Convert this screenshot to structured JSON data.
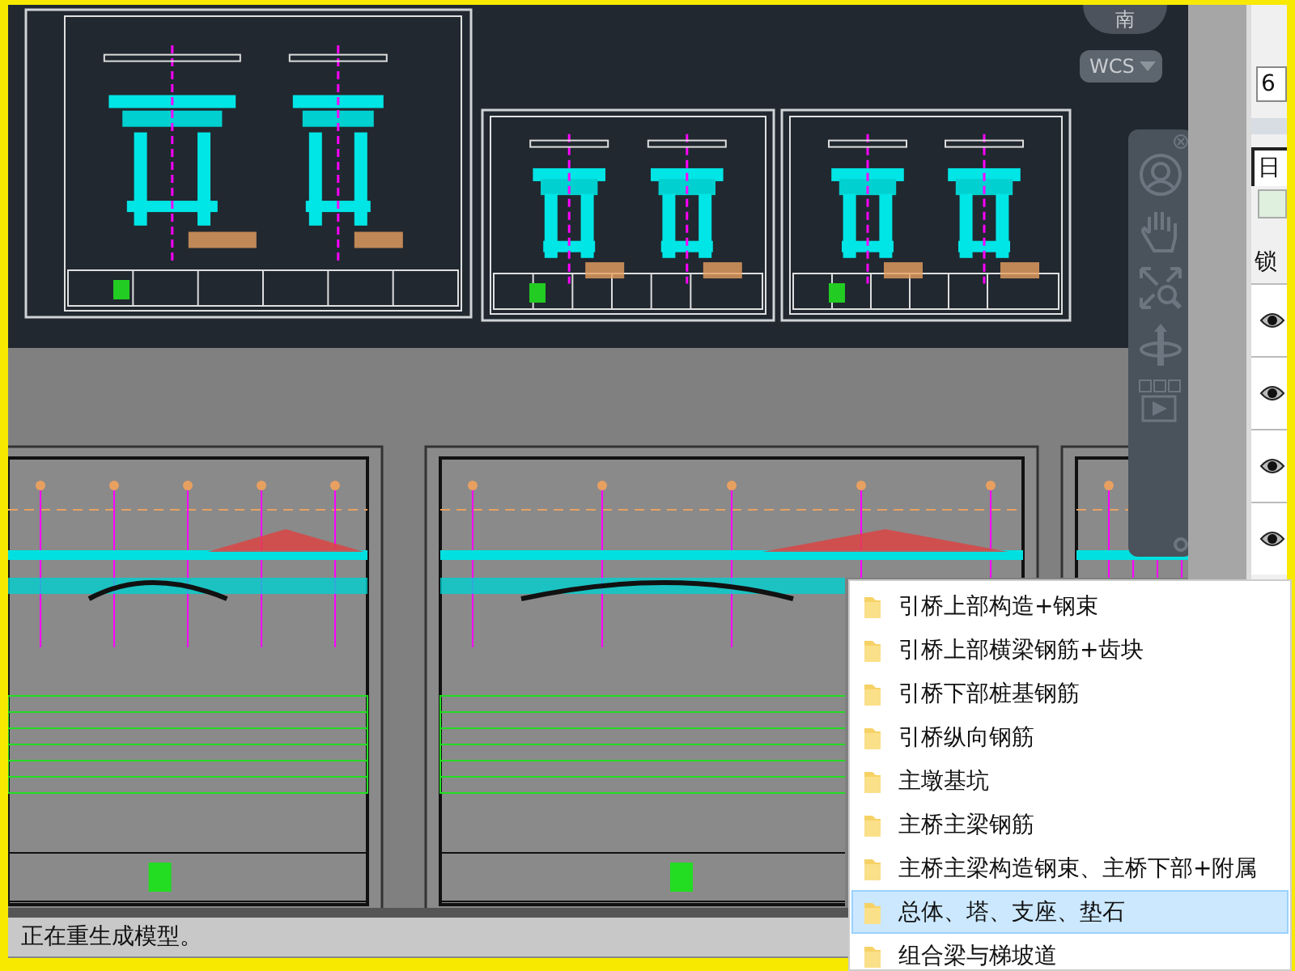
{
  "viewcube": {
    "label": "南"
  },
  "ucs_menu": {
    "label": "WCS"
  },
  "side_panel": {
    "field_value": "6",
    "tab_label": "日",
    "column_label": "锁",
    "layers": [
      {
        "visible": true
      },
      {
        "visible": true
      },
      {
        "visible": true
      },
      {
        "visible": true
      }
    ]
  },
  "popup_menu": {
    "items": [
      {
        "label": "引桥上部构造+钢束",
        "selected": false
      },
      {
        "label": "引桥上部横梁钢筋+齿块",
        "selected": false
      },
      {
        "label": "引桥下部桩基钢筋",
        "selected": false
      },
      {
        "label": "引桥纵向钢筋",
        "selected": false
      },
      {
        "label": "主墩基坑",
        "selected": false
      },
      {
        "label": "主桥主梁钢筋",
        "selected": false
      },
      {
        "label": "主桥主梁构造钢束、主桥下部+附属",
        "selected": false
      },
      {
        "label": "总体、塔、支座、垫石",
        "selected": true
      },
      {
        "label": "组合梁与梯坡道",
        "selected": false
      }
    ]
  },
  "status_bar": {
    "text": "正在重生成模型。"
  }
}
